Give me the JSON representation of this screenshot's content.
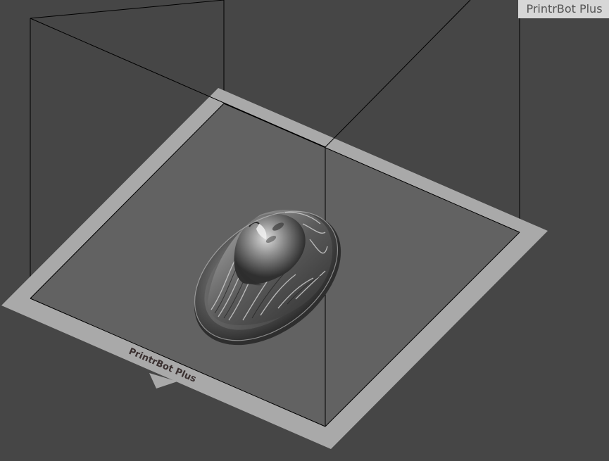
{
  "viewport": {
    "background_color": "#464646",
    "printer_name": "PrintrBot Plus",
    "bed_label": "PrintrBot Plus"
  },
  "bed": {
    "border_color": "#a9a9a9",
    "plate_color": "#626262",
    "frame_line_color": "#000000"
  },
  "model": {
    "description_icon": "face-relief-medallion-icon",
    "color": "#8a8a8a"
  }
}
